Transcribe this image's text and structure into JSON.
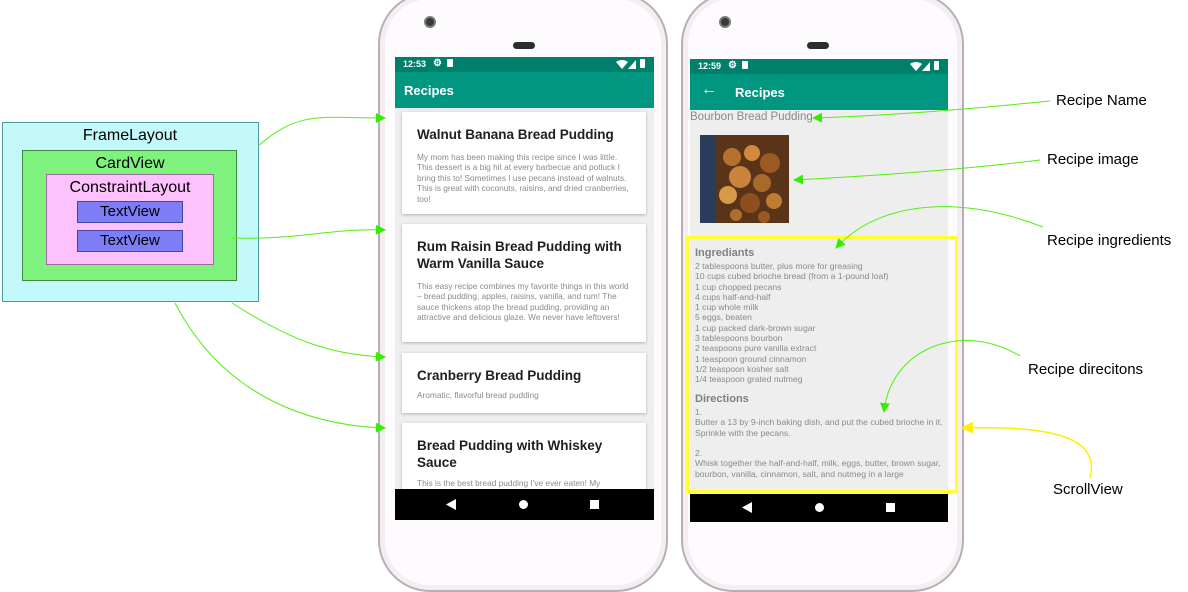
{
  "diagram": {
    "frame_layout": "FrameLayout",
    "card_view": "CardView",
    "constraint_layout": "ConstraintLayout",
    "text_view_1": "TextView",
    "text_view_2": "TextView"
  },
  "list_phone": {
    "time": "12:53",
    "title": "Recipes",
    "recipes": [
      {
        "title": "Walnut Banana Bread Pudding",
        "description": "My mom has been making this recipe since I was little. This dessert is a big hit at every barbecue and potluck I bring this to! Sometimes I use pecans instead of walnuts. This is great with coconuts, raisins, and dried cranberries, too!"
      },
      {
        "title": "Rum Raisin Bread Pudding with Warm Vanilla Sauce",
        "description": "This easy recipe combines my favorite things in this world – bread pudding, apples, raisins, vanilla, and rum! The sauce thickens atop the bread pudding, providing an attractive and delicious glaze. We never have leftovers!"
      },
      {
        "title": "Cranberry Bread Pudding",
        "description": "Aromatic, flavorful bread pudding"
      },
      {
        "title": "Bread Pudding with Whiskey Sauce",
        "description": "This is the best bread pudding I've ever eaten! My"
      }
    ]
  },
  "detail_phone": {
    "time": "12:59",
    "title": "Recipes",
    "recipe_name": "Bourbon Bread Pudding",
    "ingredients_heading": "Ingrediants",
    "ingredients": [
      "2 tablespoons butter, plus more for greasing",
      "10 cups cubed brioche bread (from a 1-pound loaf)",
      "1 cup chopped pecans",
      "4 cups half-and-half",
      "1 cup whole milk",
      "5 eggs, beaten",
      "1 cup packed dark-brown sugar",
      "3 tablespoons bourbon",
      "2 teaspoons pure vanilla extract",
      "1 teaspoon ground cinnamon",
      "1/2 teaspoon kosher salt",
      "1/4 teaspoon grated nutmeg"
    ],
    "directions_heading": "Directions",
    "directions": "1.\n Butter a 13 by 9-inch baking dish, and put the cubed brioche in it. Sprinkle with the pecans.\n\n2.\n Whisk together the half-and-half, milk, eggs, butter, brown sugar, bourbon, vanilla, cinnamon, salt, and nutmeg in a large"
  },
  "callouts": {
    "recipe_name": "Recipe Name",
    "recipe_image": "Recipe image",
    "recipe_ingredients": "Recipe ingredients",
    "recipe_directions": "Recipe direcitons",
    "scroll_view": "ScrollView"
  },
  "colors": {
    "primary": "#009680",
    "primary_dark": "#00806b",
    "green_arrow": "#33ee00",
    "yellow_arrow": "#ffee00",
    "frame_layout": "#c3f9fb",
    "card_view": "#7ef27c",
    "constraint_layout": "#fdc2fd",
    "text_view": "#7d7df7"
  },
  "icons": {
    "settings": "gear-icon",
    "sd_card": "sd-card-icon",
    "wifi": "wifi-icon",
    "signal": "signal-icon",
    "battery": "battery-icon",
    "back_arrow": "back-arrow-icon",
    "nav_back": "nav-back-icon",
    "nav_home": "nav-home-icon",
    "nav_recents": "nav-recents-icon"
  }
}
